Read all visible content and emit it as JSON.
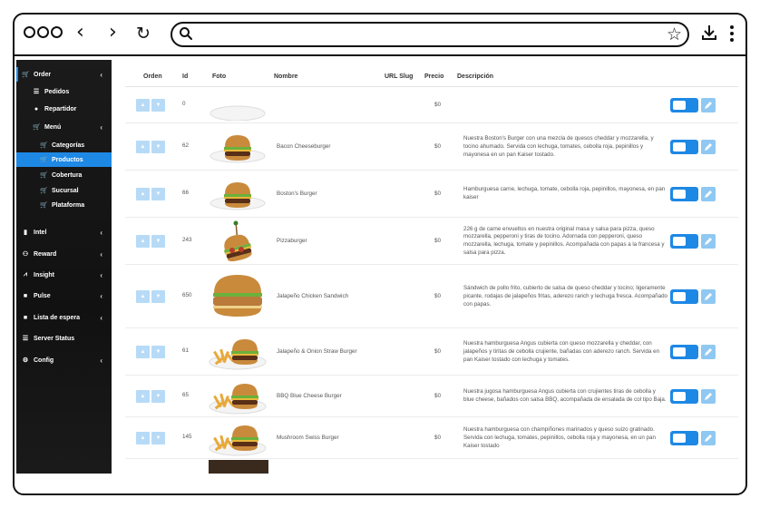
{
  "browser": {
    "url_value": "",
    "icons": [
      "window-dots-icon",
      "back-icon",
      "forward-icon",
      "reload-icon",
      "search-icon",
      "star-icon",
      "download-icon",
      "kebab-icon"
    ]
  },
  "sidebar": {
    "items": [
      {
        "label": "Order",
        "icon": "cart-icon"
      },
      {
        "label": "Pedidos",
        "icon": "list-icon"
      },
      {
        "label": "Repartidor",
        "icon": "user-icon"
      },
      {
        "label": "Menú",
        "icon": "cart-icon"
      },
      {
        "label": "Categorías",
        "icon": "cart-icon"
      },
      {
        "label": "Productos",
        "icon": "cart-icon"
      },
      {
        "label": "Cobertura",
        "icon": "cart-icon"
      },
      {
        "label": "Sucursal",
        "icon": "cart-icon"
      },
      {
        "label": "Plataforma",
        "icon": "cart-icon"
      },
      {
        "label": "Intel",
        "icon": "document-icon"
      },
      {
        "label": "Reward",
        "icon": "users-icon"
      },
      {
        "label": "Insight",
        "icon": "chart-icon"
      },
      {
        "label": "Pulse",
        "icon": "pulse-icon"
      },
      {
        "label": "Lista de espera",
        "icon": "clipboard-icon"
      },
      {
        "label": "Server Status",
        "icon": "server-icon"
      },
      {
        "label": "Config",
        "icon": "cogs-icon"
      }
    ]
  },
  "table": {
    "headers": {
      "orden": "Orden",
      "id": "Id",
      "foto": "Foto",
      "nombre": "Nombre",
      "slug": "URL Slug",
      "precio": "Precio",
      "descripcion": "Descripción"
    },
    "rows": [
      {
        "id": "0",
        "nombre": "",
        "precio": "$0",
        "descripcion": "",
        "foto": "plate-empty"
      },
      {
        "id": "62",
        "nombre": "Bacon Cheeseburger",
        "precio": "$0",
        "descripcion": "Nuestra Boston's Burger con una mezcla de quesos cheddar y mozzarella, y tocino ahumado. Servida con lechuga, tomates, cebolla roja, pepinillos y mayonesa en un pan Kaiser tostado.",
        "foto": "burger"
      },
      {
        "id": "66",
        "nombre": "Boston's Burger",
        "precio": "$0",
        "descripcion": "Hamburguesa carne, lechuga, tomate, cebolla roja, pepinillos, mayonesa, en pan kaiser",
        "foto": "burger"
      },
      {
        "id": "243",
        "nombre": "Pizzaburger",
        "precio": "$0",
        "descripcion": "226 g de carne envueltos en nuestra original masa y salsa para pizza, queso mozzarella, pepperoni y tiras de tocino. Adornada con pepperoni, queso mozzarella, lechuga, tomate y pepinillos. Acompañada con papas a la francesa y salsa para pizza.",
        "foto": "pizzaburger"
      },
      {
        "id": "650",
        "nombre": "Jalapeño Chicken Sandwich",
        "precio": "$0",
        "descripcion": "Sándwich de pollo frito, cubierto de salsa de queso cheddar y tocino; ligeramente picante, rodajas de jalapeños fritas, aderezo ranch y lechuga fresca. Acompañado con papas.",
        "foto": "sandwich"
      },
      {
        "id": "61",
        "nombre": "Jalapeño & Onion Straw Burger",
        "precio": "$0",
        "descripcion": "Nuestra hamburguesa Angus cubierta con queso mozzarella y cheddar, con jalapeños y tiritas de cebolla crujiente, bañadas con aderezo ranch. Servida en pan Kaiser tostado con lechuga y tomates.",
        "foto": "burger-fries"
      },
      {
        "id": "65",
        "nombre": "BBQ Blue Cheese Burger",
        "precio": "$0",
        "descripcion": "Nuestra jugosa hamburguesa Angus cubierta con crujientes tiras de cebolla y blue cheese, bañados con salsa BBQ, acompañada de ensalada de col tipo Baja.",
        "foto": "burger-fries"
      },
      {
        "id": "145",
        "nombre": "Mushroom Swiss Burger",
        "precio": "$0",
        "descripcion": "Nuestra hamburguesa con champiñones marinados y queso suizo gratinado. Servida con lechuga, tomates, pepinillos, cebolla roja y mayonesa, en un pan Kaiser tostado",
        "foto": "burger-fries"
      }
    ]
  },
  "colors": {
    "accent": "#1e88e5",
    "accent_light": "#b7dbf7",
    "sidebar_bg": "#111111"
  }
}
